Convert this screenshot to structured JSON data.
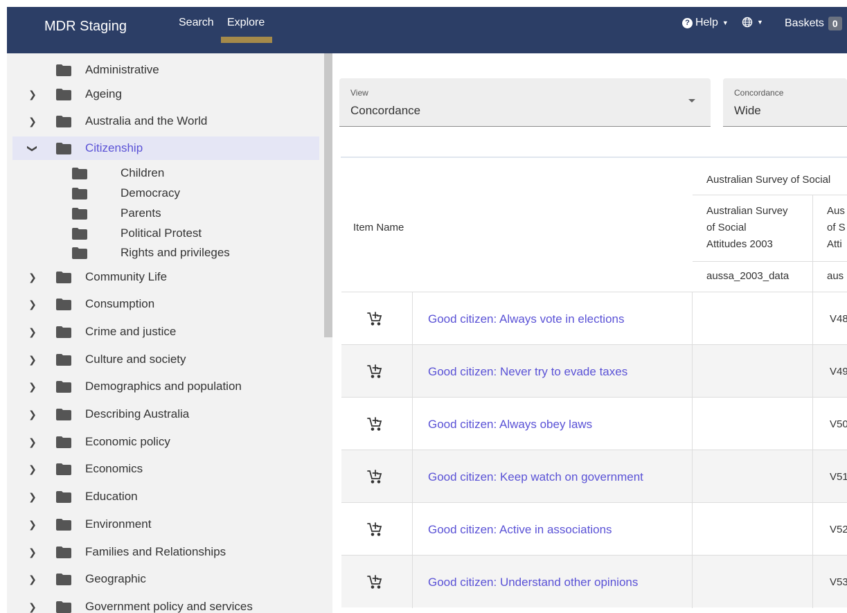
{
  "header": {
    "brand": "MDR Staging",
    "nav": [
      "Search",
      "Explore"
    ],
    "help_label": "Help",
    "baskets_label": "Baskets",
    "baskets_count": "0"
  },
  "sidebar": {
    "items": [
      {
        "label": "Administrative",
        "chevron": ""
      },
      {
        "label": "Ageing",
        "chevron": ">"
      },
      {
        "label": "Australia and the World",
        "chevron": ">"
      },
      {
        "label": "Citizenship",
        "chevron": "v",
        "selected": true
      },
      {
        "label": "Community Life",
        "chevron": ">"
      },
      {
        "label": "Consumption",
        "chevron": ">"
      },
      {
        "label": "Crime and justice",
        "chevron": ">"
      },
      {
        "label": "Culture and society",
        "chevron": ">"
      },
      {
        "label": "Demographics and population",
        "chevron": ">"
      },
      {
        "label": "Describing Australia",
        "chevron": ">"
      },
      {
        "label": "Economic policy",
        "chevron": ">"
      },
      {
        "label": "Economics",
        "chevron": ">"
      },
      {
        "label": "Education",
        "chevron": ">"
      },
      {
        "label": "Environment",
        "chevron": ">"
      },
      {
        "label": "Families and Relationships",
        "chevron": ">"
      },
      {
        "label": "Geographic",
        "chevron": ">"
      },
      {
        "label": "Government policy and services",
        "chevron": ">"
      }
    ],
    "subitems": [
      "Children",
      "Democracy",
      "Parents",
      "Political Protest",
      "Rights and privileges"
    ]
  },
  "controls": {
    "view_label": "View",
    "view_value": "Concordance",
    "concordance_label": "Concordance",
    "concordance_value": "Wide"
  },
  "table": {
    "item_name_header": "Item Name",
    "survey_group": "Australian Survey of Social",
    "col1_title": [
      "Australian Survey",
      "of Social",
      "Attitudes 2003"
    ],
    "col2_title": [
      "Aus",
      "of S",
      "Atti"
    ],
    "col1_code": "aussa_2003_data",
    "col2_code": "aus",
    "rows": [
      {
        "name": "Good citizen: Always vote in elections",
        "col1": "",
        "col2": "V48"
      },
      {
        "name": "Good citizen: Never try to evade taxes",
        "col1": "",
        "col2": "V49"
      },
      {
        "name": "Good citizen: Always obey laws",
        "col1": "",
        "col2": "V50"
      },
      {
        "name": "Good citizen: Keep watch on government",
        "col1": "",
        "col2": "V51"
      },
      {
        "name": "Good citizen: Active in associations",
        "col1": "",
        "col2": "V52"
      },
      {
        "name": "Good citizen: Understand other opinions",
        "col1": "",
        "col2": "V53"
      }
    ]
  }
}
